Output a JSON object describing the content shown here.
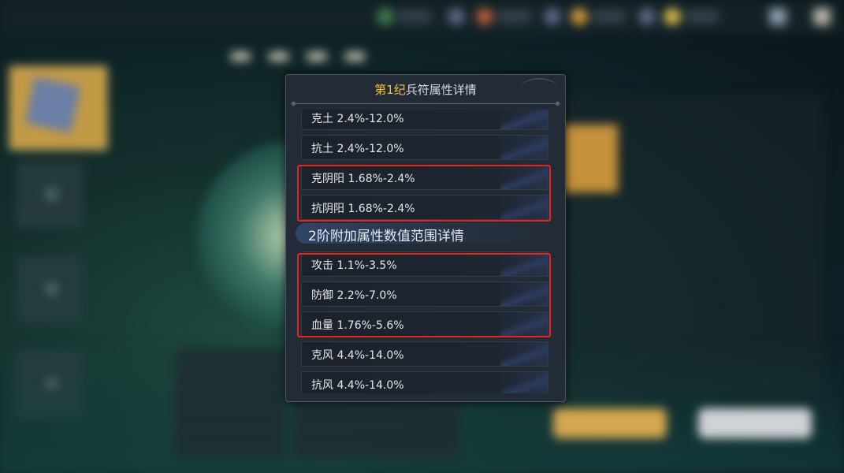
{
  "popup": {
    "title_gold": "第1纪",
    "title_rest": "兵符属性详情",
    "rows_top": [
      {
        "label": "克土 2.4%-12.0%"
      },
      {
        "label": "抗土 2.4%-12.0%"
      },
      {
        "label": "克阴阳 1.68%-2.4%"
      },
      {
        "label": "抗阴阳 1.68%-2.4%"
      }
    ],
    "section_title": "2阶附加属性数值范围详情",
    "rows_bottom": [
      {
        "label": "攻击 1.1%-3.5%"
      },
      {
        "label": "防御 2.2%-7.0%"
      },
      {
        "label": "血量 1.76%-5.6%"
      },
      {
        "label": "克风 4.4%-14.0%"
      },
      {
        "label": "抗风 4.4%-14.0%"
      }
    ]
  },
  "colors": {
    "highlight": "#e8231f",
    "title_gold": "#f2c23a",
    "popup_bg": "#232b36"
  }
}
